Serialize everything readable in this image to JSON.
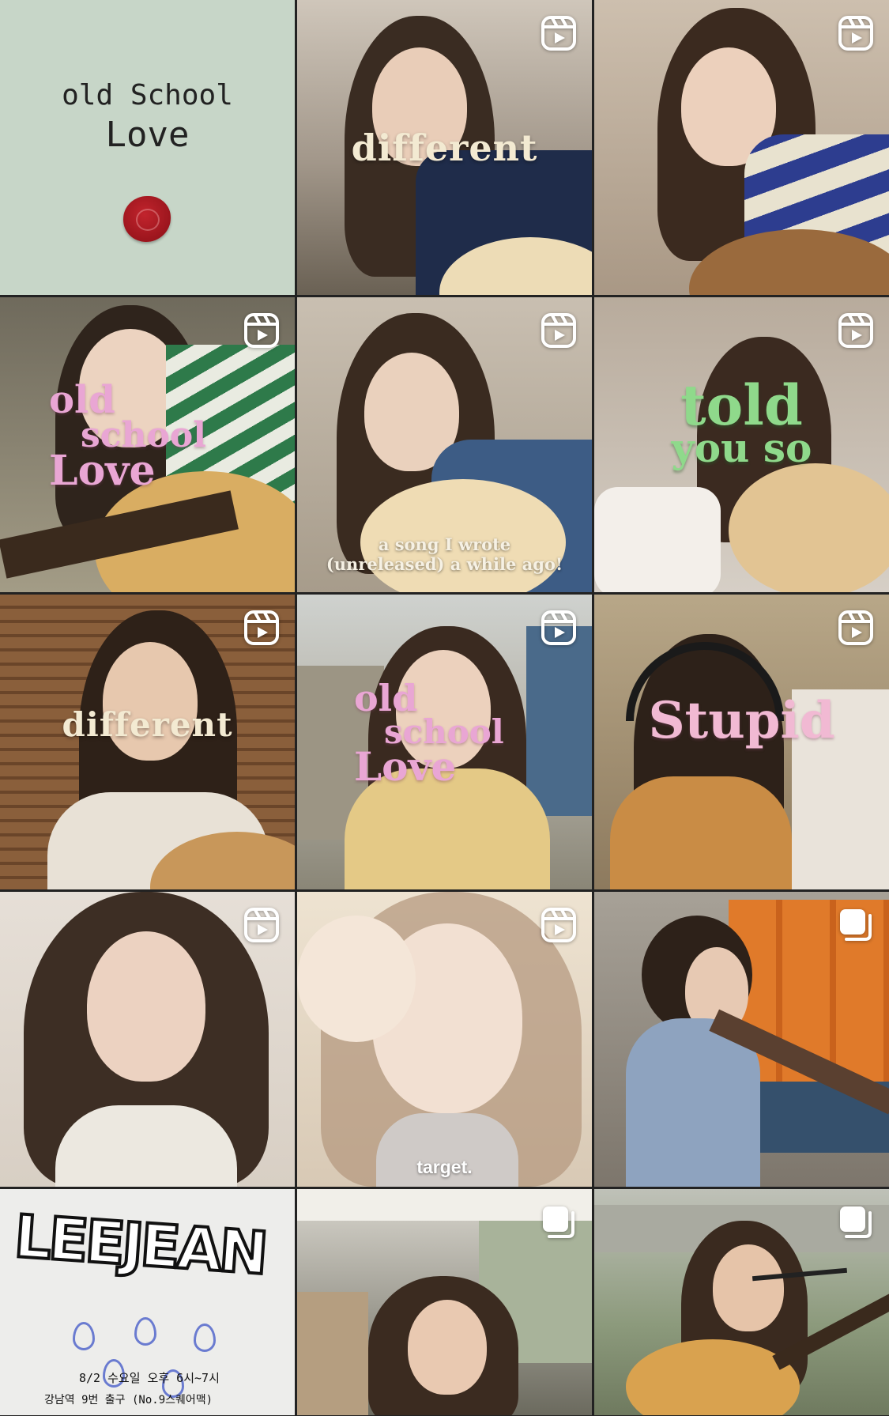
{
  "grid": {
    "tiles": [
      {
        "name": "cover",
        "badge": null,
        "text": {
          "line1": "old School",
          "line2": "Love"
        },
        "bg": "#c7d6c8"
      },
      {
        "name": "different",
        "badge": "reel-icon",
        "text": {
          "title": "different"
        },
        "bg": "#8c7a68"
      },
      {
        "name": "striped",
        "badge": "reel-icon",
        "bg": "#a79a89"
      },
      {
        "name": "oldschool-1",
        "badge": "reel-icon",
        "text": {
          "line1": "old",
          "line2": "school",
          "line3": "Love"
        },
        "bg": "#8f8a7a"
      },
      {
        "name": "song-i-wrote",
        "badge": "reel-icon",
        "text": {
          "caption1": "a song I wrote",
          "caption2": "(unreleased) a while ago!"
        },
        "bg": "#b4aa9a"
      },
      {
        "name": "told-you-so",
        "badge": "reel-icon",
        "text": {
          "line1": "told",
          "line2": "you so"
        },
        "bg": "#b7aa9c"
      },
      {
        "name": "different-2",
        "badge": "reel-icon",
        "text": {
          "title": "different"
        },
        "bg": "#7b5b40"
      },
      {
        "name": "oldschool-2",
        "badge": "reel-icon",
        "text": {
          "line1": "old",
          "line2": "school",
          "line3": "Love"
        },
        "bg": "#a7a9a7"
      },
      {
        "name": "stupid",
        "badge": "reel-icon",
        "text": {
          "title": "Stupid"
        },
        "bg": "#9b8a73"
      },
      {
        "name": "selfie",
        "badge": "reel-icon",
        "bg": "#d8cec4"
      },
      {
        "name": "target",
        "badge": "reel-icon",
        "text": {
          "caption": "target."
        },
        "bg": "#e2d5c4"
      },
      {
        "name": "graffiti",
        "badge": "carousel-icon",
        "bg": "#7e756b"
      },
      {
        "name": "poster",
        "badge": null,
        "text": {
          "logo": "LEEJEAN",
          "date": "8/2 수요일 오후 6시~7시",
          "place": "강남역 9번 출구 (No.9스퀘어맥)"
        },
        "bg": "#ededeb"
      },
      {
        "name": "car",
        "badge": "carousel-icon",
        "bg": "#6b6a5e"
      },
      {
        "name": "busking",
        "badge": "carousel-icon",
        "bg": "#9aa08e"
      }
    ]
  },
  "colors": {
    "divider": "#222222",
    "badge": "#ffffff"
  }
}
